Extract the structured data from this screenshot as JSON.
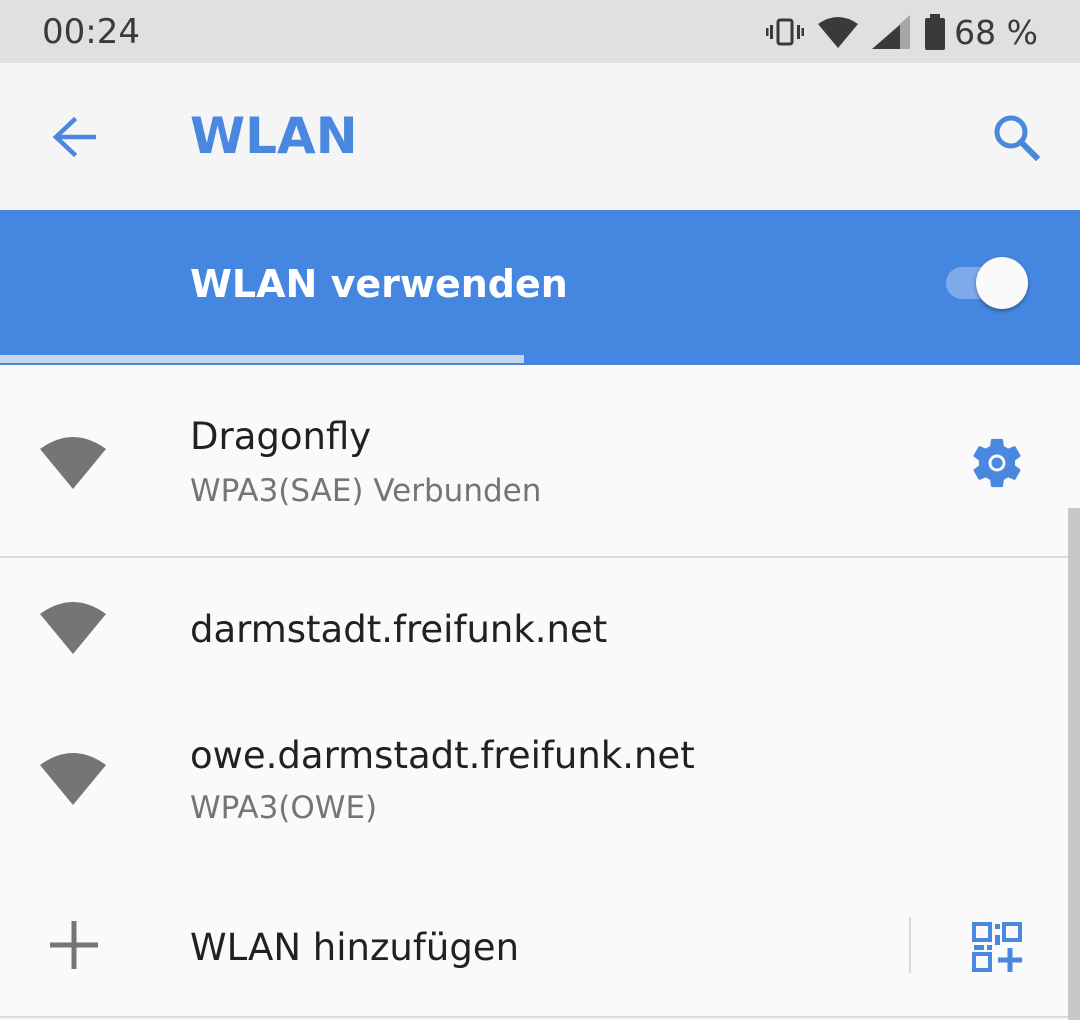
{
  "status_bar": {
    "time": "00:24",
    "battery_text": "68 %",
    "icons": [
      "vibrate-icon",
      "wifi-signal-icon",
      "cellular-signal-icon",
      "battery-icon"
    ]
  },
  "app_bar": {
    "title": "WLAN",
    "back_icon": "arrow-back-icon",
    "search_icon": "search-icon"
  },
  "master_switch": {
    "label": "WLAN verwenden",
    "enabled": true,
    "scan_progress": 0.485
  },
  "networks": [
    {
      "name": "Dragonfly",
      "summary": "WPA3(SAE) Verbunden",
      "connected": true,
      "action_icon": "gear-icon"
    },
    {
      "name": "darmstadt.freifunk.net",
      "summary": ""
    },
    {
      "name": "owe.darmstadt.freifunk.net",
      "summary": "WPA3(OWE)"
    }
  ],
  "add_network": {
    "label": "WLAN hinzufügen",
    "icon": "plus-icon",
    "qr_icon": "qr-code-scan-icon"
  },
  "colors": {
    "accent": "#4a87de",
    "switch_bar": "#4587e0",
    "icon_gray": "#757575"
  }
}
